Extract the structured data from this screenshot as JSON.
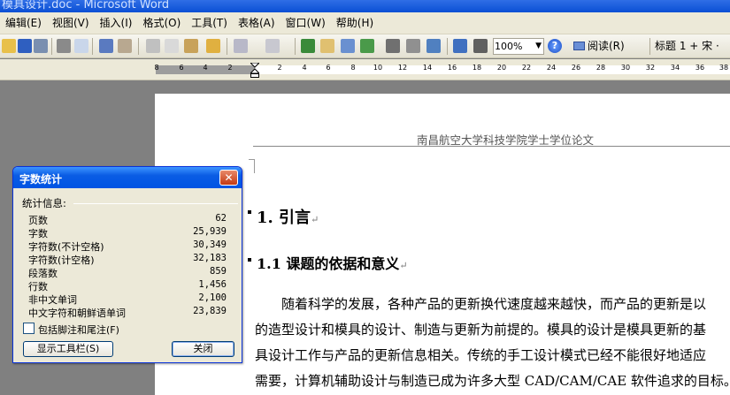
{
  "window": {
    "title": "模具设计.doc - Microsoft Word"
  },
  "menu": [
    "编辑(E)",
    "视图(V)",
    "插入(I)",
    "格式(O)",
    "工具(T)",
    "表格(A)",
    "窗口(W)",
    "帮助(H)"
  ],
  "toolbar": {
    "zoom": "100%",
    "read_label": "阅读(R)",
    "style_label": "标题 1 + 宋 ·"
  },
  "ruler": {
    "left_ticks": [
      "8",
      "6",
      "4",
      "2"
    ],
    "right_ticks": [
      "2",
      "4",
      "6",
      "8",
      "10",
      "12",
      "14",
      "16",
      "18",
      "20",
      "22",
      "24",
      "26",
      "28",
      "30",
      "32",
      "34",
      "36",
      "38"
    ]
  },
  "document": {
    "header": "南昌航空大学科技学院学士学位论文",
    "heading1": "1.  引言",
    "heading2": "1.1 课题的依据和意义",
    "paragraph_lines": [
      "随着科学的发展，各种产品的更新换代速度越来越快，而产品的更新是以",
      "的造型设计和模具的设计、制造与更新为前提的。模具的设计是模具更新的基",
      "具设计工作与产品的更新信息相关。传统的手工设计模式已经不能很好地适应",
      "需要，计算机辅助设计与制造已成为许多大型 CAD/CAM/CAE 软件追求的目标。"
    ],
    "para_mark": "↵"
  },
  "dialog": {
    "title": "字数统计",
    "close_glyph": "✕",
    "section_label": "统计信息:",
    "stats": [
      {
        "label": "页数",
        "value": "62"
      },
      {
        "label": "字数",
        "value": "25,939"
      },
      {
        "label": "字符数(不计空格)",
        "value": "30,349"
      },
      {
        "label": "字符数(计空格)",
        "value": "32,183"
      },
      {
        "label": "段落数",
        "value": "859"
      },
      {
        "label": "行数",
        "value": "1,456"
      },
      {
        "label": "非中文单词",
        "value": "2,100"
      },
      {
        "label": "中文字符和朝鲜语单词",
        "value": "23,839"
      }
    ],
    "checkbox_label": "包括脚注和尾注(F)",
    "show_toolbar_button": "显示工具栏(S)",
    "close_button": "关闭"
  },
  "colors": {
    "title_bar": "#0a4fd4",
    "dialog_title": "#0054e3",
    "dialog_bg": "#ece9d8",
    "app_bg": "#808080"
  }
}
